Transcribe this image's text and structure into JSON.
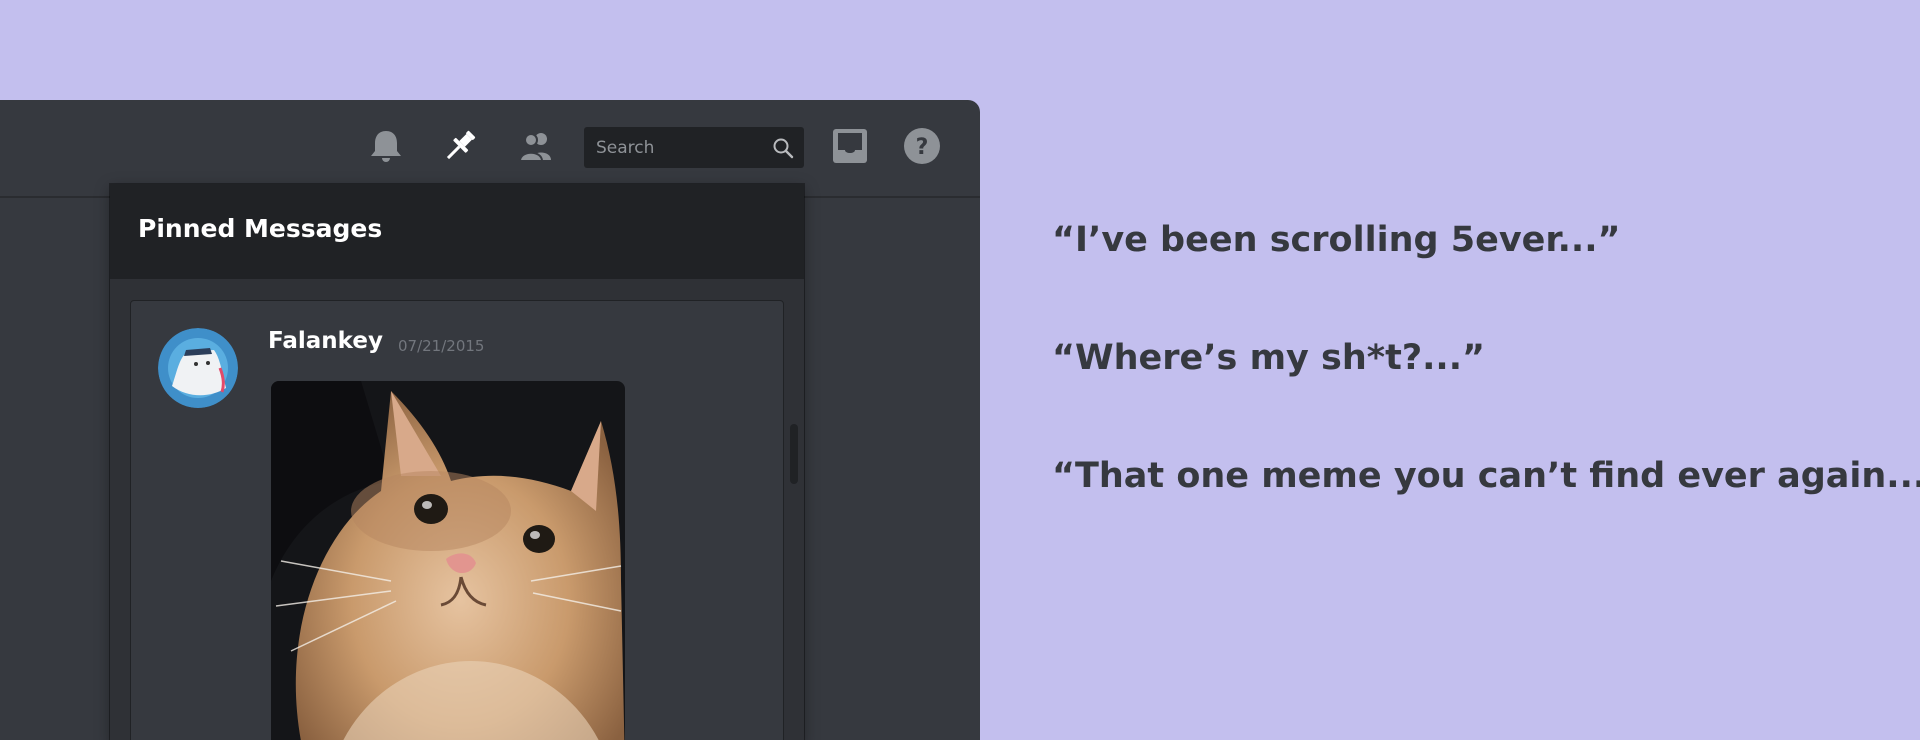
{
  "toolbar": {
    "icons": [
      "bell-icon",
      "pin-icon",
      "members-icon",
      "search-icon",
      "inbox-icon",
      "help-icon"
    ],
    "search": {
      "placeholder": "Search"
    }
  },
  "pinned": {
    "title": "Pinned Messages",
    "message": {
      "author": "Falankey",
      "date": "07/21/2015",
      "avatar": "avatar-icon",
      "attachment": "cat-photo"
    }
  },
  "quotes": [
    "“I’ve been scrolling 5ever...”",
    "“Where’s my sh*t?...”",
    "“That one meme you can’t find ever again...”"
  ],
  "colors": {
    "background": "#c3bfee",
    "window": "#36393f",
    "panel": "#2f3136",
    "panel_header": "#202225",
    "quote_text": "#36393f"
  }
}
